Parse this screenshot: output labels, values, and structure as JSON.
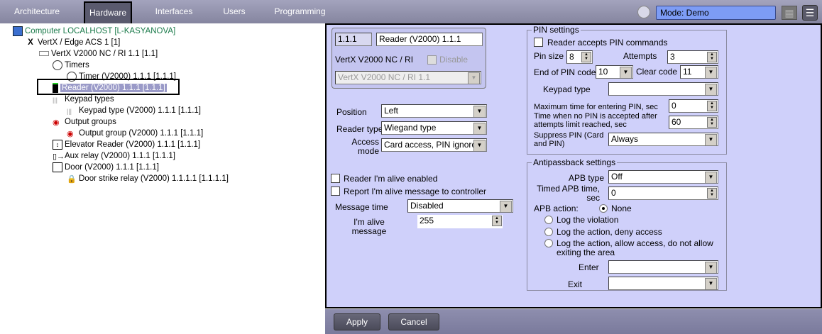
{
  "tabs": [
    {
      "label": "Architecture"
    },
    {
      "label": "Hardware"
    },
    {
      "label": "Interfaces"
    },
    {
      "label": "Users"
    },
    {
      "label": "Programming"
    }
  ],
  "mode": "Mode: Demo",
  "tree": [
    {
      "label": "Computer LOCALHOST [L-KASYANOVA]",
      "icon": "computer-icon"
    },
    {
      "label": "VertX / Edge ACS 1 [1]",
      "icon": "vertx-icon"
    },
    {
      "label": "VertX V2000 NC / RI 1.1 [1.1]",
      "icon": "controller-icon"
    },
    {
      "label": "Timers",
      "icon": "timer-icon"
    },
    {
      "label": "Timer (V2000) 1.1.1 [1.1.1]",
      "icon": "timer-icon"
    },
    {
      "label": "Reader (V2000) 1.1.1 [1.1.1]",
      "icon": "reader-icon"
    },
    {
      "label": "Keypad types",
      "icon": "keypad-icon"
    },
    {
      "label": "Keypad type (V2000) 1.1.1 [1.1.1]",
      "icon": "keypad-icon"
    },
    {
      "label": "Output groups",
      "icon": "output-icon"
    },
    {
      "label": "Output group (V2000) 1.1.1 [1.1.1]",
      "icon": "output-icon"
    },
    {
      "label": "Elevator Reader (V2000) 1.1.1 [1.1.1]",
      "icon": "elevator-icon"
    },
    {
      "label": "Aux relay (V2000) 1.1.1 [1.1.1]",
      "icon": "relay-icon"
    },
    {
      "label": "Door (V2000) 1.1.1 [1.1.1]",
      "icon": "door-icon"
    },
    {
      "label": "Door strike relay (V2000) 1.1.1.1 [1.1.1.1]",
      "icon": "lock-icon"
    }
  ],
  "header": {
    "id": "1.1.1",
    "name": "Reader (V2000) 1.1.1",
    "parent": "VertX V2000 NC / RI",
    "disable": "Disable",
    "parent_select": "VertX V2000 NC / RI 1.1"
  },
  "reader": {
    "position_label": "Position",
    "position": "Left",
    "type_label": "Reader type",
    "type": "Wiegand type",
    "access_label": "Access mode",
    "access": "Card access, PIN ignored",
    "alive_enabled": "Reader I'm alive enabled",
    "report_alive": "Report I'm alive message to controller",
    "msg_time_label": "Message time",
    "msg_time": "Disabled",
    "alive_msg_label": "I'm alive message",
    "alive_msg": "255"
  },
  "pin": {
    "title": "PIN settings",
    "accepts": "Reader accepts PIN commands",
    "size_label": "Pin size",
    "size": "8",
    "attempts_label": "Attempts",
    "attempts": "3",
    "end_label": "End of PIN code",
    "end": "10",
    "clear_label": "Clear code",
    "clear": "11",
    "keypad_label": "Keypad type",
    "keypad": "",
    "max_label": "Maximum time for entering PIN, sec",
    "max": "0",
    "lock_label": "Time when no PIN is accepted after attempts limit reached, sec",
    "lock": "60",
    "suppress_label": "Suppress PIN (Card and PIN)",
    "suppress": "Always"
  },
  "apb": {
    "title": "Antipassback settings",
    "type_label": "APB type",
    "type": "Off",
    "timed_label": "Timed APB time, sec",
    "timed": "0",
    "action_label": "APB action:",
    "none": "None",
    "opt1": "Log the violation",
    "opt2": "Log the action, deny access",
    "opt3": "Log the action, allow access, do not allow exiting the area",
    "enter_label": "Enter",
    "exit_label": "Exit"
  },
  "buttons": {
    "apply": "Apply",
    "cancel": "Cancel"
  }
}
